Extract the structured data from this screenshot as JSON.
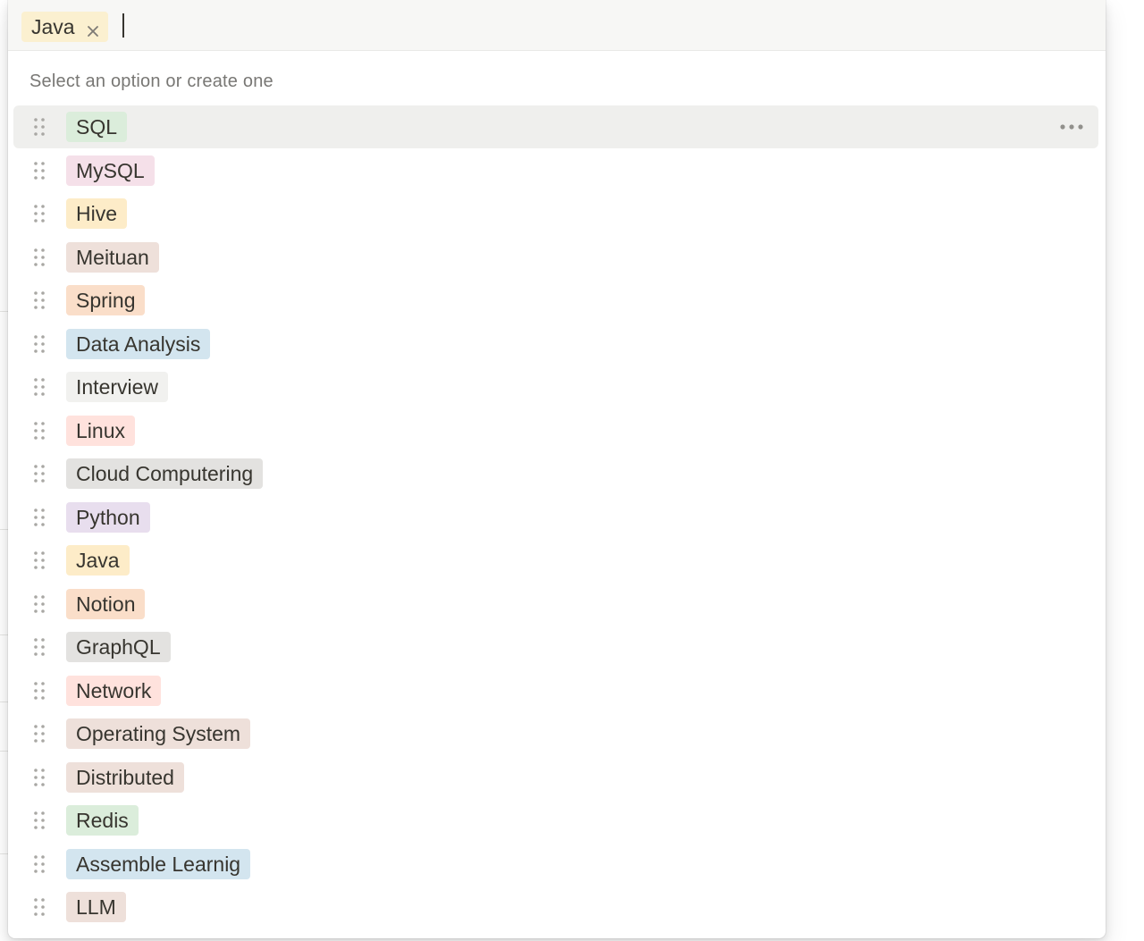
{
  "selected": {
    "label": "Java",
    "color": "#fbf0d0",
    "remove_icon": "close-icon"
  },
  "input": {
    "value": "",
    "placeholder": ""
  },
  "hint": "Select an option or create one",
  "highlighted_index": 0,
  "options": [
    {
      "label": "SQL",
      "color": "#dbeddb"
    },
    {
      "label": "MySQL",
      "color": "#f5e0e9"
    },
    {
      "label": "Hive",
      "color": "#fdecc8"
    },
    {
      "label": "Meituan",
      "color": "#eee0da"
    },
    {
      "label": "Spring",
      "color": "#fadec9"
    },
    {
      "label": "Data Analysis",
      "color": "#d3e5ef"
    },
    {
      "label": "Interview",
      "color": "#f1f1ef"
    },
    {
      "label": "Linux",
      "color": "#ffe2dd"
    },
    {
      "label": "Cloud Computering",
      "color": "#e3e2e0"
    },
    {
      "label": "Python",
      "color": "#e8deee"
    },
    {
      "label": "Java",
      "color": "#fdecc8"
    },
    {
      "label": "Notion",
      "color": "#fadec9"
    },
    {
      "label": "GraphQL",
      "color": "#e3e2e0"
    },
    {
      "label": "Network",
      "color": "#ffe2dd"
    },
    {
      "label": "Operating System",
      "color": "#eee0da"
    },
    {
      "label": "Distributed",
      "color": "#eee0da"
    },
    {
      "label": "Redis",
      "color": "#dbeddb"
    },
    {
      "label": "Assemble Learnig",
      "color": "#d3e5ef"
    },
    {
      "label": "LLM",
      "color": "#eee0da"
    }
  ],
  "icons": {
    "drag": "drag-handle-icon",
    "more": "more-horizontal-icon"
  },
  "colors": {
    "text": "#37352f",
    "hint": "#787774",
    "hover": "#efefed",
    "input_bar": "#f7f7f5"
  }
}
